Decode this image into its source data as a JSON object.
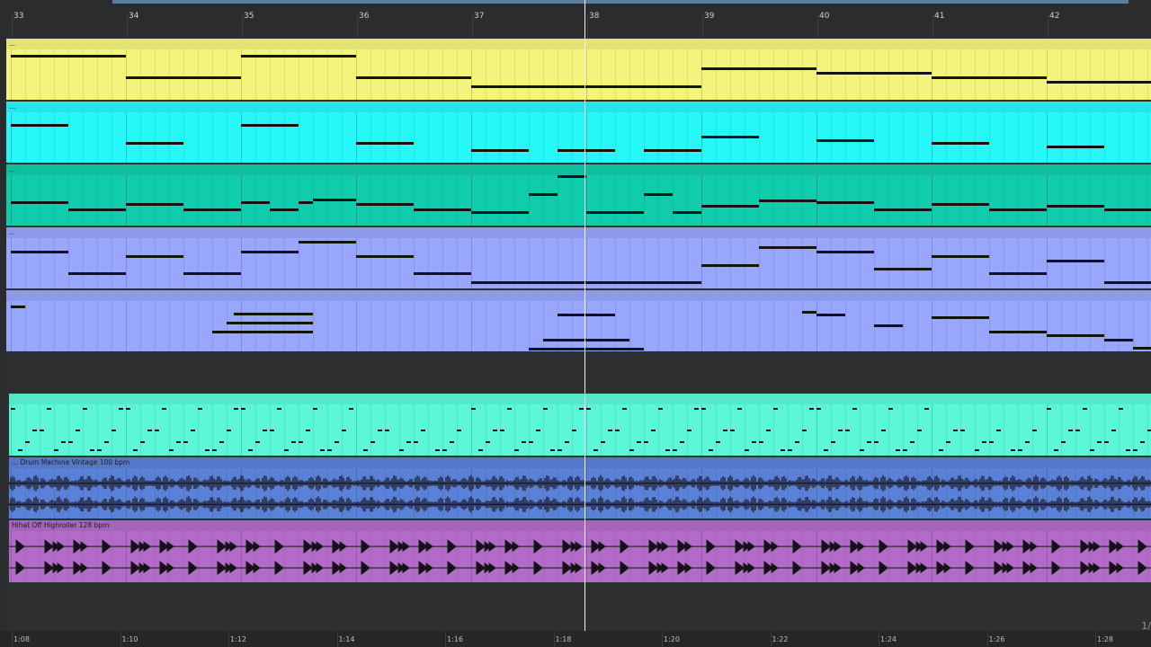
{
  "timeline": {
    "bar_labels": [
      "33",
      "34",
      "35",
      "36",
      "37",
      "38",
      "39",
      "40",
      "41",
      "42"
    ],
    "time_labels": [
      "1:08",
      "1:10",
      "1:12",
      "1:14",
      "1:16",
      "1:18",
      "1:20",
      "1:22",
      "1:24",
      "1:26",
      "1:28"
    ],
    "zoom_fraction": "1/"
  },
  "tracks": [
    {
      "kind": "midi",
      "title": "...",
      "color": "#f4f37e",
      "grid": "#c9c85e"
    },
    {
      "kind": "midi",
      "title": "...",
      "color": "#27f7f7",
      "grid": "#1ec4c6"
    },
    {
      "kind": "midi",
      "title": "...",
      "color": "#10ccaa",
      "grid": "#0ea286"
    },
    {
      "kind": "midi",
      "title": "...",
      "color": "#98a6fb",
      "grid": "#7a86d0"
    },
    {
      "kind": "midi",
      "title": "",
      "color": "#98a6fb",
      "grid": "#7a86d0"
    },
    {
      "kind": "empty"
    },
    {
      "kind": "midi",
      "title": "",
      "color": "#5cf7d9",
      "grid": "#45c9b1"
    },
    {
      "kind": "audio",
      "title": "... Drum Machine Vintage 100 bpm",
      "color": "#5a80d8",
      "grid": "#4a69b4"
    },
    {
      "kind": "audio",
      "title": "Hihat Off Highroller 128 bpm",
      "color": "#b26bc9",
      "grid": "#9257a6"
    },
    {
      "kind": "empty"
    }
  ],
  "colors": {
    "background": "#2a2b2d",
    "playhead": "#f3f3f3",
    "note": "#141414",
    "waveform": "#141414"
  }
}
